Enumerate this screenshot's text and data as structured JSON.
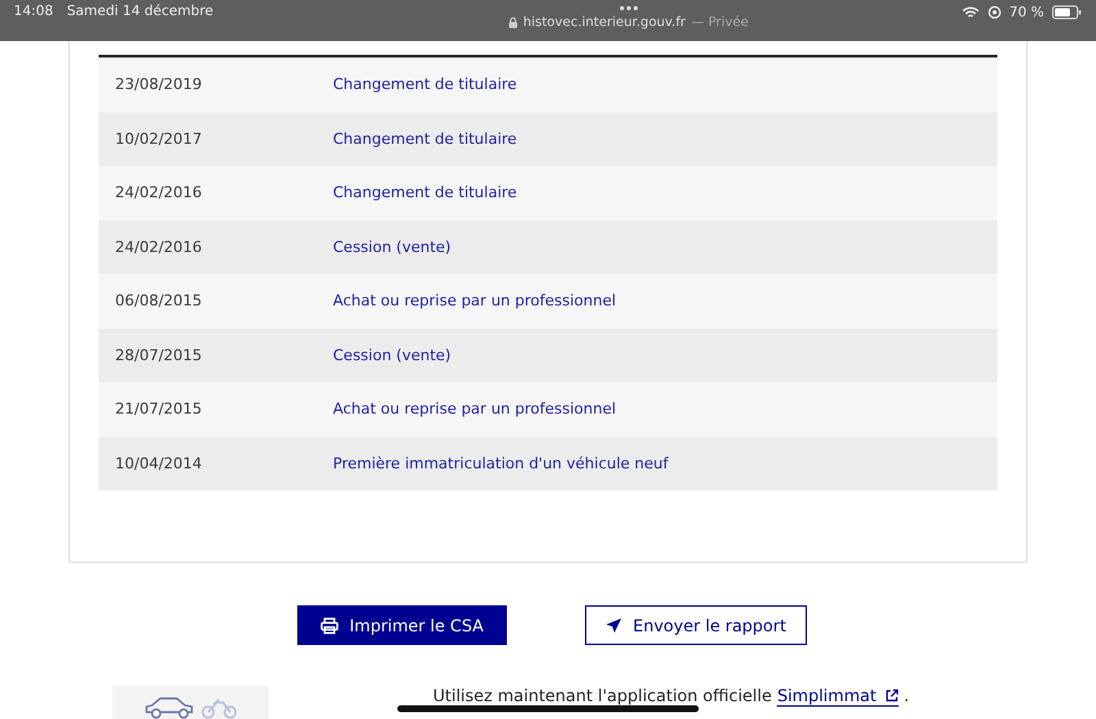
{
  "status_bar": {
    "time": "14:08",
    "date": "Samedi 14 décembre",
    "url": "histovec.interieur.gouv.fr",
    "private_label": "— Privée",
    "battery": "70 %"
  },
  "history": {
    "rows": [
      {
        "date": "23/08/2019",
        "event": "Changement de titulaire"
      },
      {
        "date": "10/02/2017",
        "event": "Changement de titulaire"
      },
      {
        "date": "24/02/2016",
        "event": "Changement de titulaire"
      },
      {
        "date": "24/02/2016",
        "event": "Cession (vente)"
      },
      {
        "date": "06/08/2015",
        "event": "Achat ou reprise par un professionnel"
      },
      {
        "date": "28/07/2015",
        "event": "Cession (vente)"
      },
      {
        "date": "21/07/2015",
        "event": "Achat ou reprise par un professionnel"
      },
      {
        "date": "10/04/2014",
        "event": "Première immatriculation d'un véhicule neuf"
      }
    ]
  },
  "actions": [
    {
      "label": "Imprimer le CSA",
      "kind": "primary"
    },
    {
      "label": "Envoyer le rapport",
      "kind": "secondary"
    }
  ],
  "promo": {
    "text": "Utilisez maintenant l'application officielle",
    "link": "Simplimmat",
    "after": "."
  }
}
